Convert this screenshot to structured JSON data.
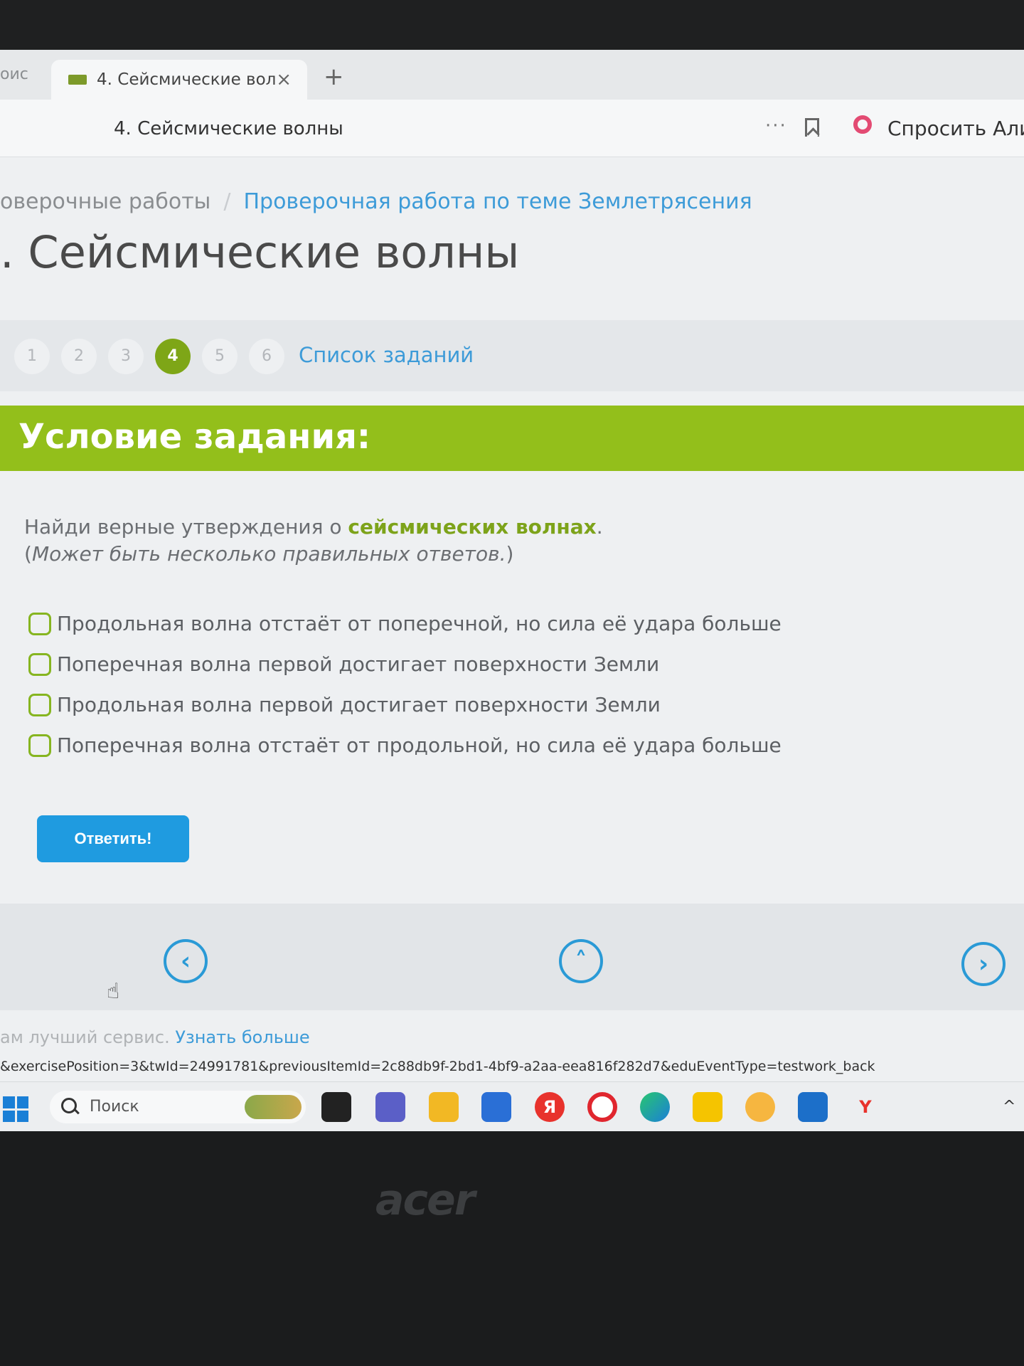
{
  "browser": {
    "prev_tab": "оис",
    "active_tab": "4. Сейсмические волн",
    "tab_close": "×",
    "new_tab": "+",
    "page_title": "4. Сейсмические волны",
    "more": "···",
    "alice": "Спросить Алис"
  },
  "breadcrumb": {
    "parent": "оверочные работы",
    "separator": "/",
    "current": "Проверочная работа по теме Землетрясения"
  },
  "heading": ". Сейсмические волны",
  "pager": {
    "pages": [
      "1",
      "2",
      "3",
      "4",
      "5",
      "6"
    ],
    "active": "4",
    "task_list": "Список заданий"
  },
  "banner_title": "Условие задания:",
  "question": {
    "before": "Найди верные утверждения о ",
    "highlight": "сейсмических волнах",
    "after": ".",
    "note_open": "(",
    "note": "Может быть несколько правильных ответов.",
    "note_close": ")"
  },
  "options": [
    "Продольная волна отстаёт от поперечной, но сила её удара больше",
    "Поперечная волна первой достигает поверхности Земли",
    "Продольная волна первой достигает поверхности Земли",
    "Поперечная волна отстаёт от продольной, но сила её удара больше"
  ],
  "submit": "Ответить!",
  "nav": {
    "prev": "‹",
    "up": "˄",
    "next": "›"
  },
  "footer": {
    "text": "ам лучший сервис. ",
    "link": "Узнать больше"
  },
  "status_url": "&exercisePosition=3&twId=24991781&previousItemId=2c88db9f-2bd1-4bf9-a2aa-eea816f282d7&eduEventType=testwork_back",
  "taskbar": {
    "search_placeholder": "Поиск",
    "yandex_letter": "Я",
    "y_letter": "Y"
  },
  "brand": "acer",
  "colors": {
    "accent_green": "#93bf1b",
    "link_blue": "#3d9bd8",
    "button_blue": "#1f9be0"
  }
}
